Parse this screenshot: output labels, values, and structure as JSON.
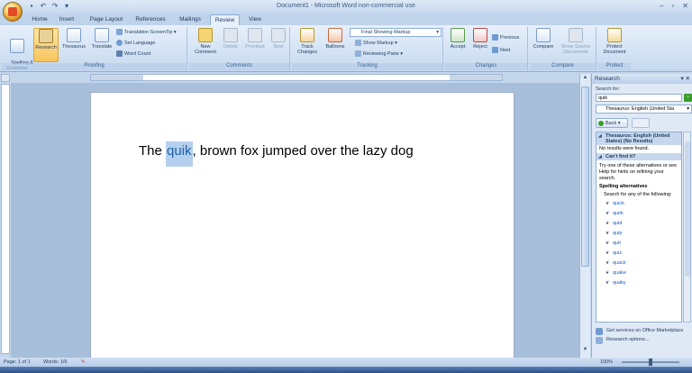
{
  "window": {
    "title": "Document1 - Microsoft Word non-commercial use"
  },
  "tabs": [
    {
      "label": "Home"
    },
    {
      "label": "Insert"
    },
    {
      "label": "Page Layout"
    },
    {
      "label": "References"
    },
    {
      "label": "Mailings"
    },
    {
      "label": "Review",
      "active": true
    },
    {
      "label": "View"
    }
  ],
  "ribbon": {
    "proofing": {
      "group": "Proofing",
      "spelling": "Spelling &\nGrammar",
      "research": "Research",
      "thesaurus": "Thesaurus",
      "translate": "Translate",
      "translation_tip": "Translation ScreenTip",
      "set_language": "Set Language",
      "word_count": "Word Count"
    },
    "comments": {
      "group": "Comments",
      "new_comment": "New\nComment",
      "delete": "Delete",
      "previous": "Previous",
      "next": "Next"
    },
    "tracking": {
      "group": "Tracking",
      "track_changes": "Track\nChanges",
      "balloons": "Balloons",
      "markup_select": "Final Showing Markup",
      "show_markup": "Show Markup",
      "reviewing_pane": "Reviewing Pane"
    },
    "changes": {
      "group": "Changes",
      "accept": "Accept",
      "reject": "Reject",
      "previous": "Previous",
      "next": "Next"
    },
    "compare": {
      "group": "Compare",
      "compare": "Compare",
      "show_source": "Show Source\nDocuments"
    },
    "protect": {
      "group": "Protect",
      "protect_doc": "Protect\nDocument"
    }
  },
  "document": {
    "before": "The ",
    "highlight": "quik",
    "after": ", brown fox jumped over the lazy dog"
  },
  "research": {
    "pane_title": "Research",
    "search_for_label": "Search for:",
    "search_value": "quik",
    "source_select": "Thesaurus: English (United Sta",
    "back_label": "Back",
    "section1_title": "Thesaurus: English (United States) (No Results)",
    "no_results": "No results were found.",
    "section2_title": "Can't find it?",
    "help_text": "Try one of these alternatives or see Help for hints on refining your search.",
    "spelling_title": "Spelling alternatives",
    "search_any": "Search for any of the following:",
    "suggestions": [
      "quick",
      "quirk",
      "quid",
      "quip",
      "quit",
      "quiz",
      "quack",
      "quake",
      "quaky"
    ],
    "footer_services": "Get services on Office Marketplace",
    "footer_options": "Research options..."
  },
  "status": {
    "page": "Page: 1 of 1",
    "words": "Words: 1/9",
    "zoom": "100%"
  }
}
